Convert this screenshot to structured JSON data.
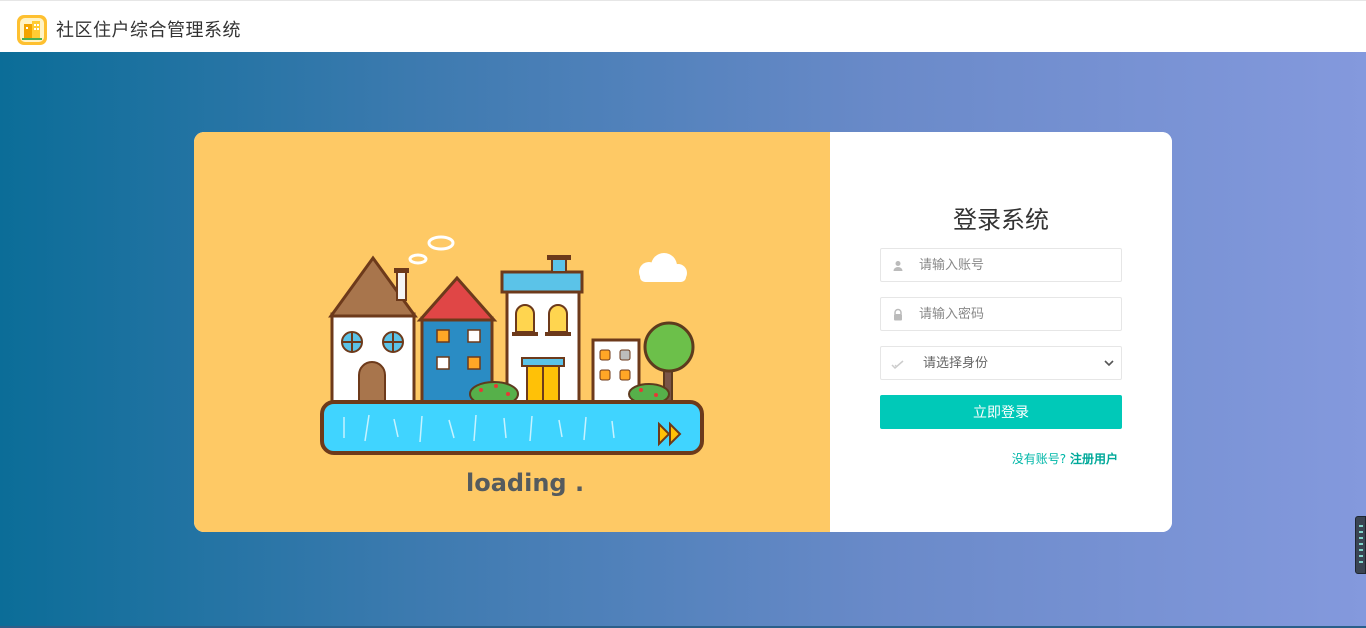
{
  "app": {
    "title": "社区住户综合管理系统",
    "logo_icon": "building-logo-icon"
  },
  "illustration": {
    "loading_text": "loading ."
  },
  "login": {
    "title": "登录系统",
    "username_placeholder": "请输入账号",
    "password_placeholder": "请输入密码",
    "role_select": {
      "selected": "请选择身份",
      "options": [
        "请选择身份"
      ]
    },
    "submit_label": "立即登录",
    "register_prompt": "没有账号?",
    "register_link": "注册用户"
  },
  "colors": {
    "accent": "#00c9b8",
    "illustration_bg": "#fec965",
    "gradient_start": "#0b6d98",
    "gradient_end": "#8499dd"
  }
}
